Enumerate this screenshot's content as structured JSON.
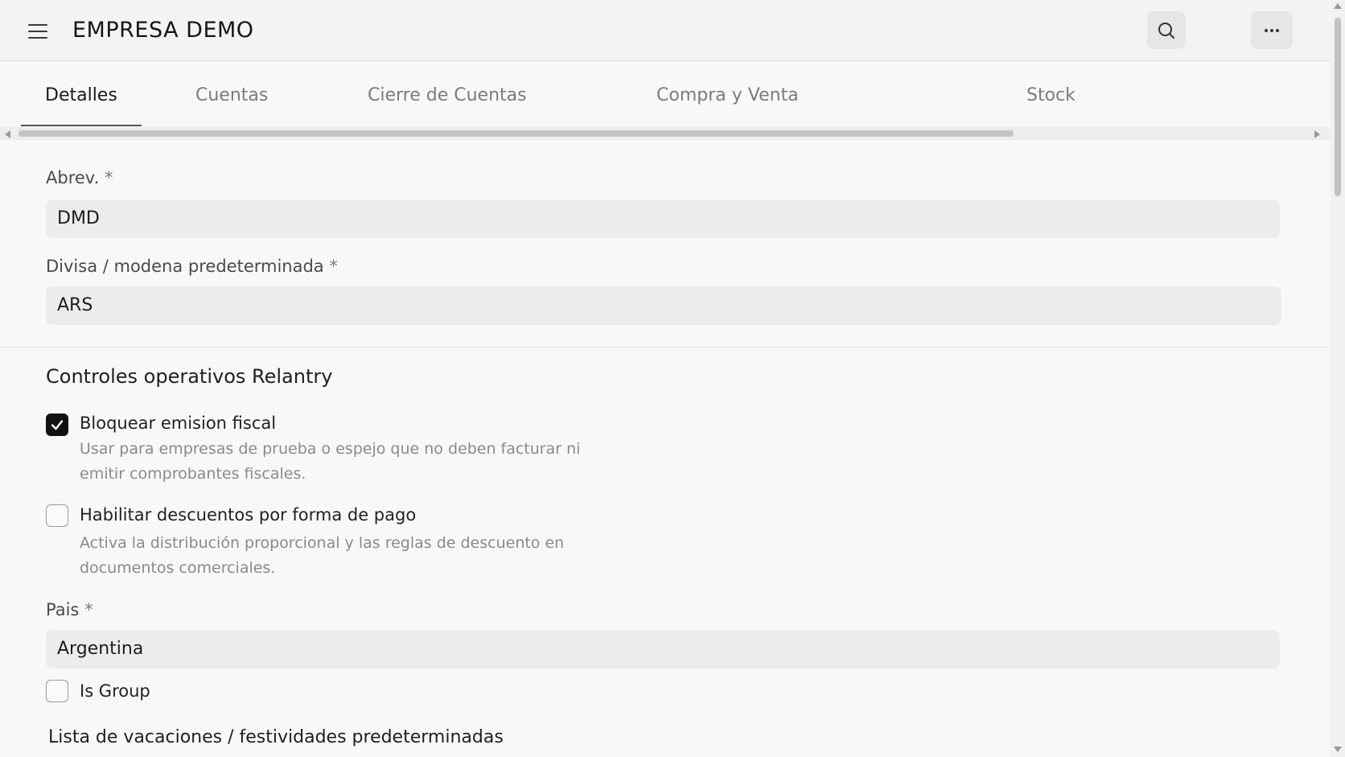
{
  "header": {
    "title": "EMPRESA DEMO"
  },
  "tabs": [
    {
      "label": "Detalles",
      "active": true
    },
    {
      "label": "Cuentas",
      "active": false
    },
    {
      "label": "Cierre de Cuentas",
      "active": false
    },
    {
      "label": "Compra y Venta",
      "active": false
    },
    {
      "label": "Stock",
      "active": false
    }
  ],
  "form": {
    "abbr": {
      "label": "Abrev.",
      "required_mark": "*",
      "value": "DMD"
    },
    "currency": {
      "label": "Divisa / modena predeterminada",
      "required_mark": "*",
      "value": "ARS"
    },
    "section_title": "Controles operativos Relantry",
    "block_fiscal": {
      "label": "Bloquear emision fiscal",
      "checked": true,
      "description": "Usar para empresas de prueba o espejo que no deben facturar ni emitir comprobantes fiscales."
    },
    "payment_discounts": {
      "label": "Habilitar descuentos por forma de pago",
      "checked": false,
      "description": "Activa la distribución proporcional y las reglas de descuento en documentos comerciales."
    },
    "country": {
      "label": "Pais",
      "required_mark": "*",
      "value": "Argentina"
    },
    "is_group": {
      "label": "Is Group",
      "checked": false
    },
    "holiday_list_heading": "Lista de vacaciones / festividades predeterminadas"
  },
  "icons": {
    "menu": "hamburger-menu-icon",
    "search": "search-icon",
    "more": "more-horizontal-icon",
    "check": "checkmark-icon"
  }
}
